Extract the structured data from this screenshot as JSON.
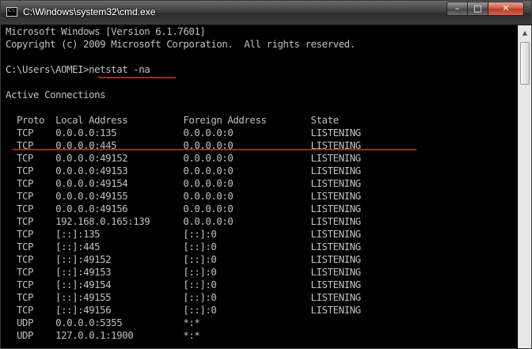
{
  "window": {
    "title": "C:\\Windows\\system32\\cmd.exe",
    "icon_label": "C:\\",
    "controls": {
      "minimize": "–",
      "maximize": "□",
      "close": "✕"
    }
  },
  "console": {
    "lines": [
      "Microsoft Windows [Version 6.1.7601]",
      "Copyright (c) 2009 Microsoft Corporation.  All rights reserved.",
      "",
      "C:\\Users\\AOMEI>netstat -na",
      "",
      "Active Connections",
      "",
      "  Proto  Local Address          Foreign Address        State",
      "  TCP    0.0.0.0:135            0.0.0.0:0              LISTENING",
      "  TCP    0.0.0.0:445            0.0.0.0:0              LISTENING",
      "  TCP    0.0.0.0:49152          0.0.0.0:0              LISTENING",
      "  TCP    0.0.0.0:49153          0.0.0.0:0              LISTENING",
      "  TCP    0.0.0.0:49154          0.0.0.0:0              LISTENING",
      "  TCP    0.0.0.0:49155          0.0.0.0:0              LISTENING",
      "  TCP    0.0.0.0:49156          0.0.0.0:0              LISTENING",
      "  TCP    192.168.0.165:139      0.0.0.0:0              LISTENING",
      "  TCP    [::]:135               [::]:0                 LISTENING",
      "  TCP    [::]:445               [::]:0                 LISTENING",
      "  TCP    [::]:49152             [::]:0                 LISTENING",
      "  TCP    [::]:49153             [::]:0                 LISTENING",
      "  TCP    [::]:49154             [::]:0                 LISTENING",
      "  TCP    [::]:49155             [::]:0                 LISTENING",
      "  TCP    [::]:49156             [::]:0                 LISTENING",
      "  UDP    0.0.0.0:5355           *:*",
      "  UDP    127.0.0.1:1900         *:*"
    ]
  },
  "annotation_color": "#d11414",
  "scrollbar": {
    "up": "▲"
  }
}
